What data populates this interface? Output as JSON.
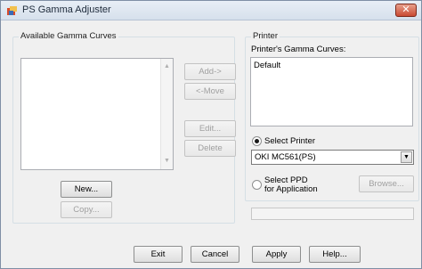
{
  "window": {
    "title": "PS Gamma Adjuster",
    "close_glyph": "✕"
  },
  "available": {
    "label": "Available Gamma Curves",
    "items": []
  },
  "middle_buttons": {
    "add": "Add->",
    "move": "<-Move",
    "edit": "Edit...",
    "delete": "Delete"
  },
  "left_buttons": {
    "new": "New...",
    "copy": "Copy..."
  },
  "printer": {
    "group_label": "Printer",
    "curves_label": "Printer's Gamma Curves:",
    "curves": [
      "Default"
    ],
    "select_printer_label": "Select Printer",
    "printer_selected": "OKI MC561(PS)",
    "select_ppd_label_1": "Select PPD",
    "select_ppd_label_2": "for Application",
    "browse": "Browse...",
    "path_value": ""
  },
  "bottom_buttons": {
    "exit": "Exit",
    "cancel": "Cancel",
    "apply": "Apply",
    "help": "Help..."
  },
  "icons": {
    "app": "app-icon",
    "scroll_up": "▲",
    "scroll_down": "▼",
    "dropdown": "▼"
  },
  "colors": {
    "title_bg": "#dae3ee",
    "close_bg": "#c94a33",
    "dialog_bg": "#f0f0f0"
  }
}
